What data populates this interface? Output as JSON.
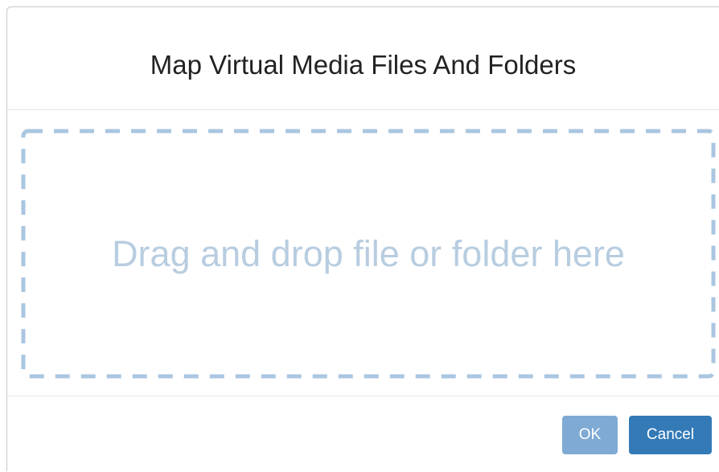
{
  "dialog": {
    "title": "Map Virtual Media Files And Folders",
    "drop_zone_text": "Drag and drop file or folder here",
    "ok_label": "OK",
    "cancel_label": "Cancel"
  },
  "colors": {
    "title_text": "#222222",
    "drop_zone_border": "#aac6e0",
    "drop_zone_text": "#b8cde0",
    "ok_button_disabled": "#7faad4",
    "cancel_button": "#337ab7"
  }
}
